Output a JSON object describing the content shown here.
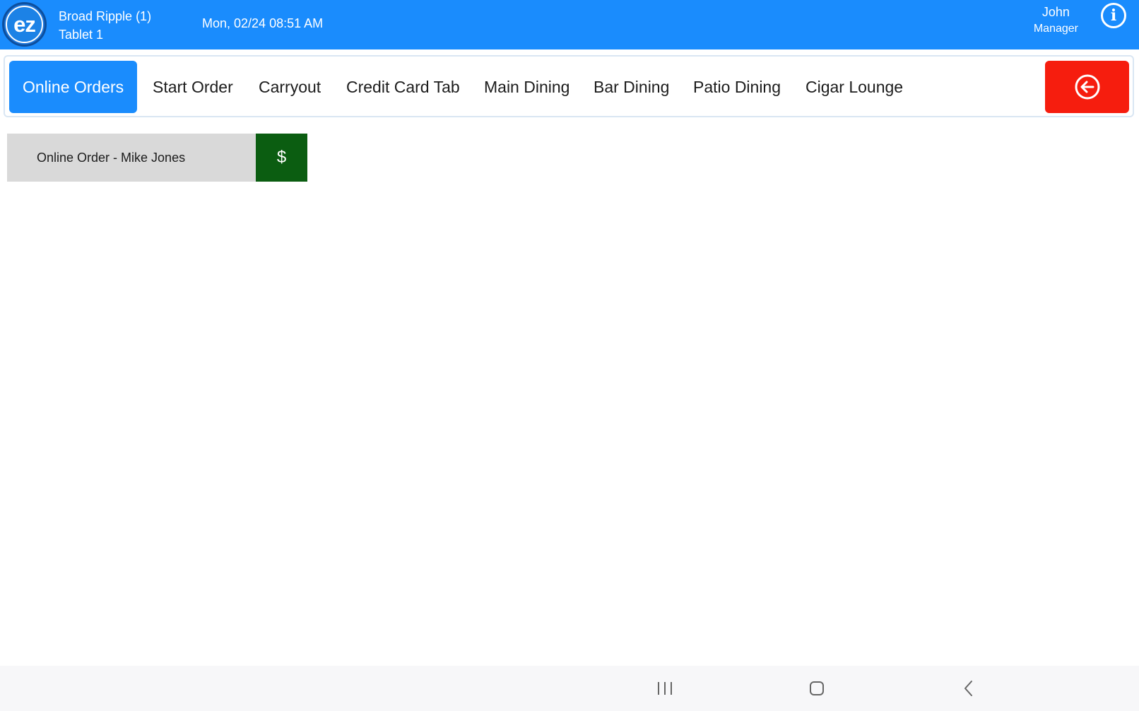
{
  "header": {
    "logo_text": "ez",
    "location": "Broad Ripple (1)",
    "device": "Tablet 1",
    "datetime": "Mon, 02/24 08:51 AM",
    "user_name": "John",
    "user_role": "Manager",
    "info_icon": "info-icon",
    "brand_color": "#1a8cfd"
  },
  "tabs": [
    {
      "label": "Online Orders",
      "active": true
    },
    {
      "label": "Start Order",
      "active": false
    },
    {
      "label": "Carryout",
      "active": false
    },
    {
      "label": "Credit Card Tab",
      "active": false
    },
    {
      "label": "Main Dining",
      "active": false
    },
    {
      "label": "Bar Dining",
      "active": false
    },
    {
      "label": "Patio Dining",
      "active": false
    },
    {
      "label": "Cigar Lounge",
      "active": false
    }
  ],
  "back_button": {
    "icon": "arrow-left-circle-icon",
    "color": "#f61d0e"
  },
  "orders": [
    {
      "label": "Online Order - Mike Jones",
      "pay_label": "$",
      "pay_color": "#0b5d11"
    }
  ],
  "system_nav": {
    "icons": [
      "recent-apps-icon",
      "home-icon",
      "back-icon"
    ]
  }
}
